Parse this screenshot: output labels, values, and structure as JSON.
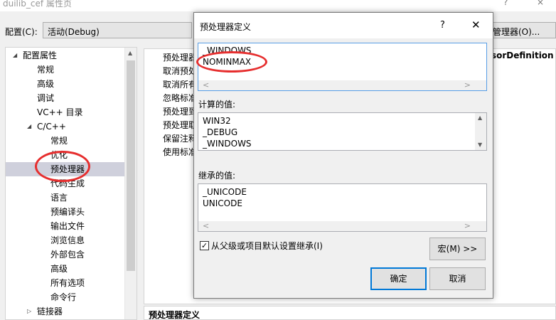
{
  "window": {
    "title": "duilib_cef 属性页",
    "help": "?",
    "close": "×"
  },
  "config": {
    "label": "配置(C):",
    "value": "活动(Debug)",
    "manager_button": "管理器(O)..."
  },
  "tree": {
    "items": [
      {
        "label": "配置属性",
        "arrow": "◢"
      },
      {
        "label": "常规"
      },
      {
        "label": "高级"
      },
      {
        "label": "调试"
      },
      {
        "label": "VC++ 目录"
      },
      {
        "label": "C/C++",
        "arrow": "◢"
      },
      {
        "label": "常规"
      },
      {
        "label": "优化"
      },
      {
        "label": "预处理器",
        "selected": true
      },
      {
        "label": "代码生成"
      },
      {
        "label": "语言"
      },
      {
        "label": "预编译头"
      },
      {
        "label": "输出文件"
      },
      {
        "label": "浏览信息"
      },
      {
        "label": "外部包含"
      },
      {
        "label": "高级"
      },
      {
        "label": "所有选项"
      },
      {
        "label": "命令行"
      },
      {
        "label": "链接器",
        "arrow": "▷"
      }
    ]
  },
  "properties": {
    "rows": [
      "预处理器",
      "取消预处",
      "取消所有",
      "忽略标准",
      "预处理到",
      "预处理取",
      "保留注释",
      "使用标准"
    ],
    "value_header_tail": "sorDefinition",
    "description_title": "预处理器定义"
  },
  "dialog": {
    "title": "预处理器定义",
    "help": "?",
    "close": "✕",
    "edit_lines": [
      "_WINDOWS",
      "NOMINMAX"
    ],
    "computed_label": "计算的值:",
    "computed_lines": [
      "WIN32",
      "_DEBUG",
      "_WINDOWS"
    ],
    "inherited_label": "继承的值:",
    "inherited_lines": [
      "_UNICODE",
      "UNICODE"
    ],
    "inherit_checkbox_label": "从父级或项目默认设置继承(I)",
    "inherit_checked": true,
    "macro_button": "宏(M) >>",
    "ok_button": "确定",
    "cancel_button": "取消"
  }
}
